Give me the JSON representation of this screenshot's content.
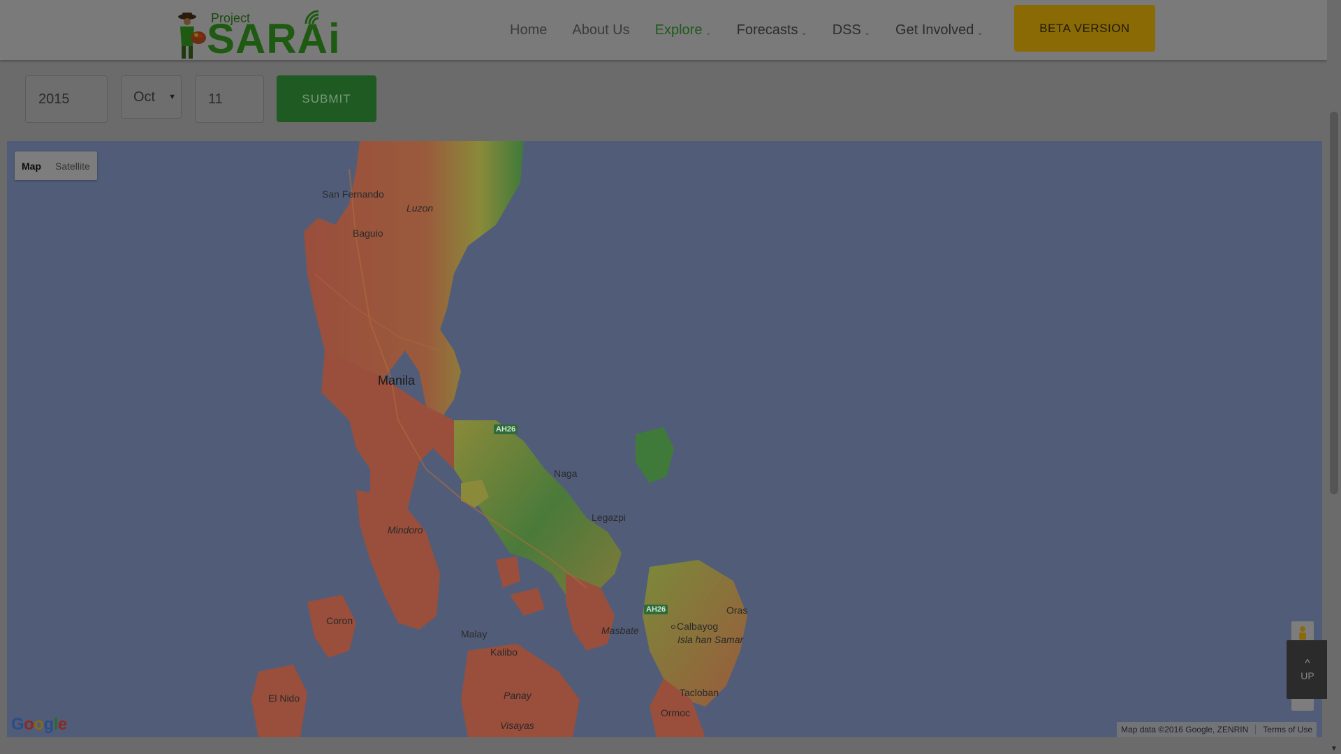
{
  "logo": {
    "small": "Project",
    "big": "SARAi"
  },
  "nav": {
    "home": "Home",
    "about": "About Us",
    "explore": "Explore",
    "forecasts": "Forecasts",
    "dss": "DSS",
    "involved": "Get Involved",
    "chevron": "⌄"
  },
  "beta_label": "BETA VERSION",
  "form": {
    "year": "2015",
    "month": "Oct",
    "day": "11",
    "submit_label": "SUBMIT"
  },
  "map": {
    "type_map": "Map",
    "type_satellite": "Satellite",
    "places": {
      "san_fernando": "San Fernando",
      "luzon": "Luzon",
      "baguio": "Baguio",
      "manila": "Manila",
      "naga": "Naga",
      "legazpi": "Legazpi",
      "mindoro": "Mindoro",
      "coron": "Coron",
      "masbate": "Masbate",
      "calbayog": "Calbayog",
      "samar": "Isla han Samar",
      "oras": "Oras",
      "malay": "Malay",
      "kalibo": "Kalibo",
      "tacloban": "Tacloban",
      "panay": "Panay",
      "ormoc": "Ormoc",
      "el_nido": "El Nido",
      "visayas": "Visayas"
    },
    "shield_1": "AH26",
    "shield_2": "AH26",
    "google": [
      "G",
      "o",
      "o",
      "g",
      "l",
      "e"
    ],
    "attribution": "Map data ©2016 Google, ZENRIN",
    "terms": "Terms of Use",
    "colors": {
      "water": "#515d78",
      "land_low": "#9a4e3c",
      "land_mid": "#8a8a3a",
      "land_high": "#3f7a3a"
    }
  },
  "up_button": {
    "caret": "^",
    "label": "UP"
  }
}
